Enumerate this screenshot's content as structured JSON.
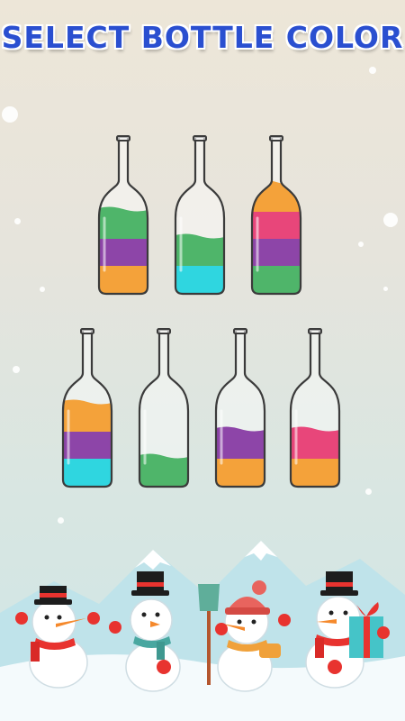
{
  "title": "SELECT BOTTLE COLOR",
  "colors": {
    "green": "#4fb56a",
    "purple": "#8d45a8",
    "orange": "#f4a23a",
    "cyan": "#2fd6e0",
    "pink": "#e8467a",
    "title_blue": "#2a4fd0"
  },
  "bottles": [
    {
      "id": "bottle-1",
      "layers": [
        "orange",
        "purple",
        "green"
      ]
    },
    {
      "id": "bottle-2",
      "layers": [
        "cyan",
        "green"
      ]
    },
    {
      "id": "bottle-3",
      "layers": [
        "green",
        "purple",
        "pink",
        "orange"
      ]
    },
    {
      "id": "bottle-4",
      "layers": [
        "cyan",
        "purple",
        "orange"
      ]
    },
    {
      "id": "bottle-5",
      "layers": [
        "green"
      ]
    },
    {
      "id": "bottle-6",
      "layers": [
        "orange",
        "purple"
      ]
    },
    {
      "id": "bottle-7",
      "layers": [
        "orange",
        "pink"
      ]
    }
  ],
  "snowmen": [
    {
      "name": "snowman-top-hat-red-scarf",
      "hat": "top-hat",
      "scarf": "red"
    },
    {
      "name": "snowman-top-hat-teal-scarf",
      "hat": "top-hat",
      "scarf": "teal"
    },
    {
      "name": "snowman-beanie-orange-scarf",
      "hat": "beanie",
      "scarf": "orange"
    },
    {
      "name": "snowman-top-hat-gift",
      "hat": "top-hat",
      "scarf": "red"
    }
  ]
}
